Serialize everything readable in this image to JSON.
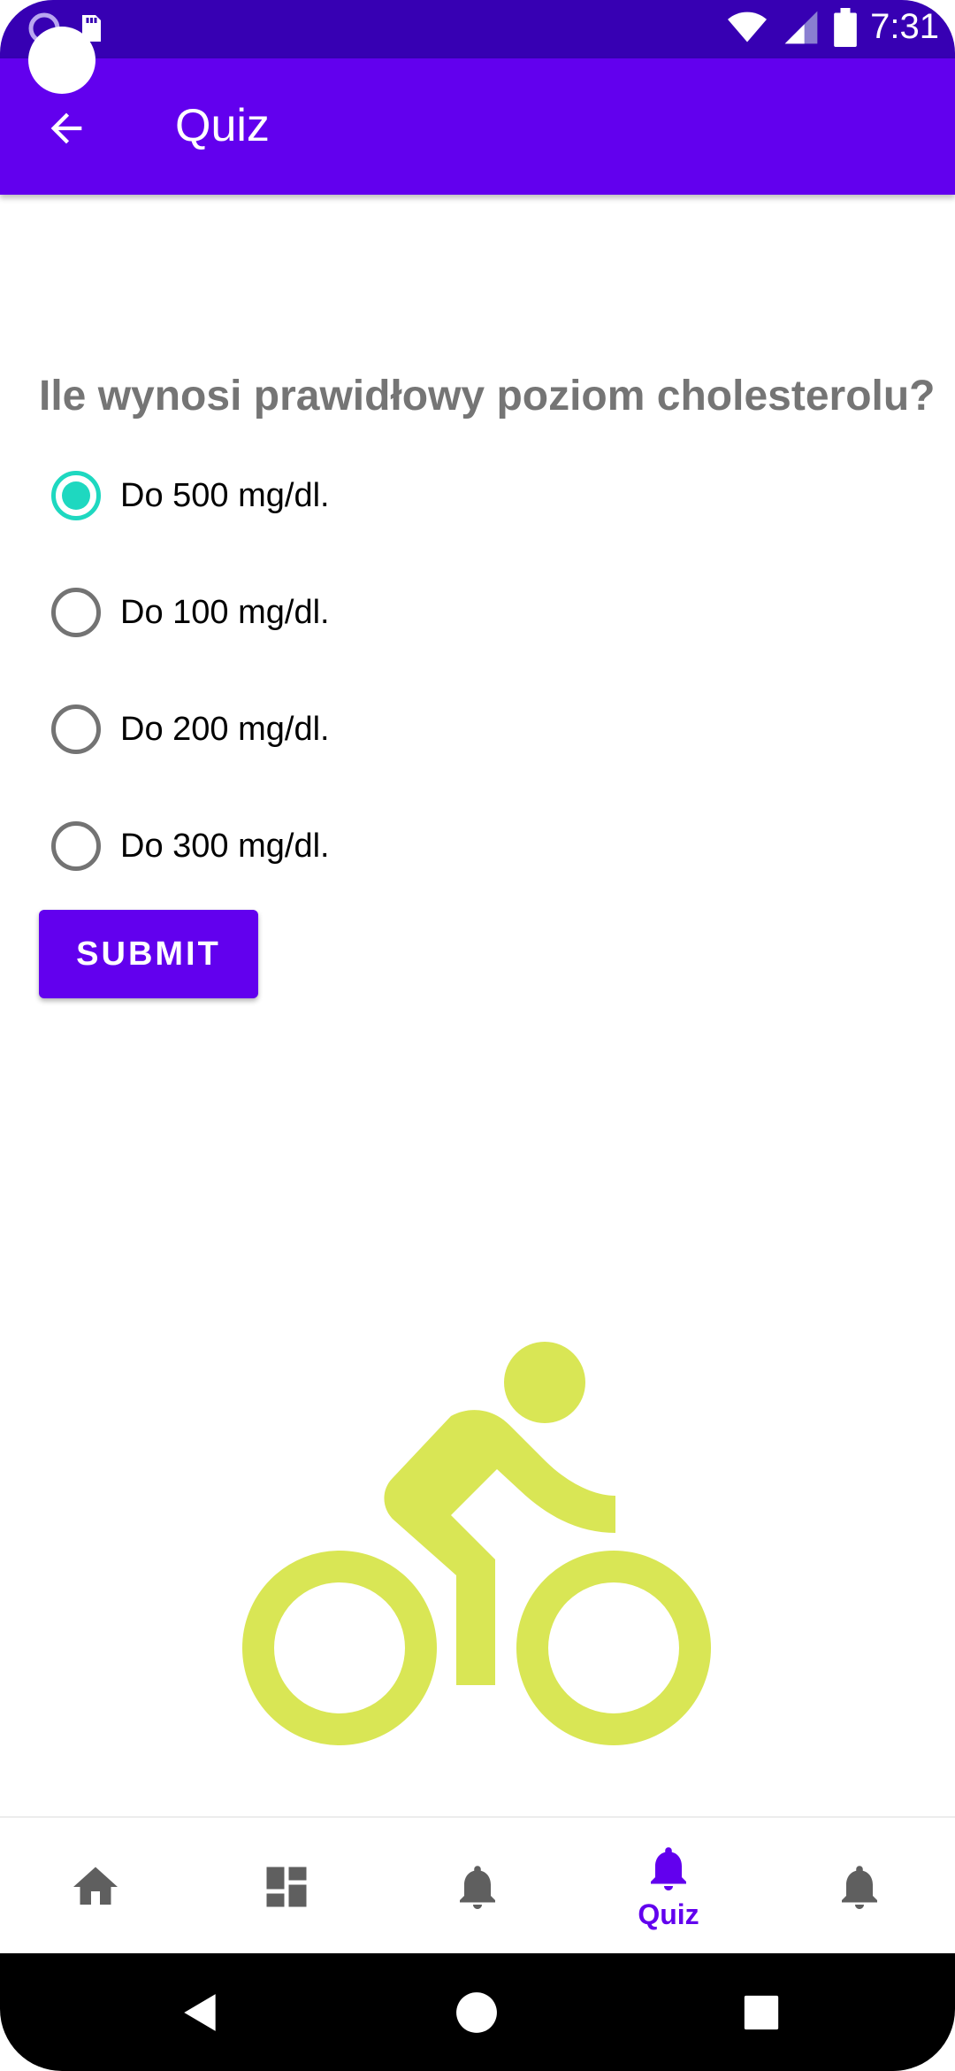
{
  "status_bar": {
    "time": "7:31"
  },
  "app_bar": {
    "title": "Quiz"
  },
  "quiz": {
    "question": "Ile wynosi prawidłowy poziom cholesterolu?",
    "options": [
      {
        "label": "Do 500 mg/dl.",
        "checked": true
      },
      {
        "label": "Do 100 mg/dl.",
        "checked": false
      },
      {
        "label": "Do 200 mg/dl.",
        "checked": false
      },
      {
        "label": "Do 300 mg/dl.",
        "checked": false
      }
    ],
    "submit_label": "SUBMIT"
  },
  "illustration": {
    "icon": "bike-icon",
    "color": "#d9e655"
  },
  "bottom_nav": {
    "items": [
      {
        "icon": "home-icon",
        "label": "",
        "active": false
      },
      {
        "icon": "dashboard-icon",
        "label": "",
        "active": false
      },
      {
        "icon": "bell-icon",
        "label": "",
        "active": false
      },
      {
        "icon": "bell-icon",
        "label": "Quiz",
        "active": true
      },
      {
        "icon": "bell-icon",
        "label": "",
        "active": false
      }
    ]
  },
  "colors": {
    "primary": "#6200ee",
    "primary_dark": "#3700b3",
    "accent": "#1ed8c0",
    "inactive_icon": "#5f5f5f"
  }
}
